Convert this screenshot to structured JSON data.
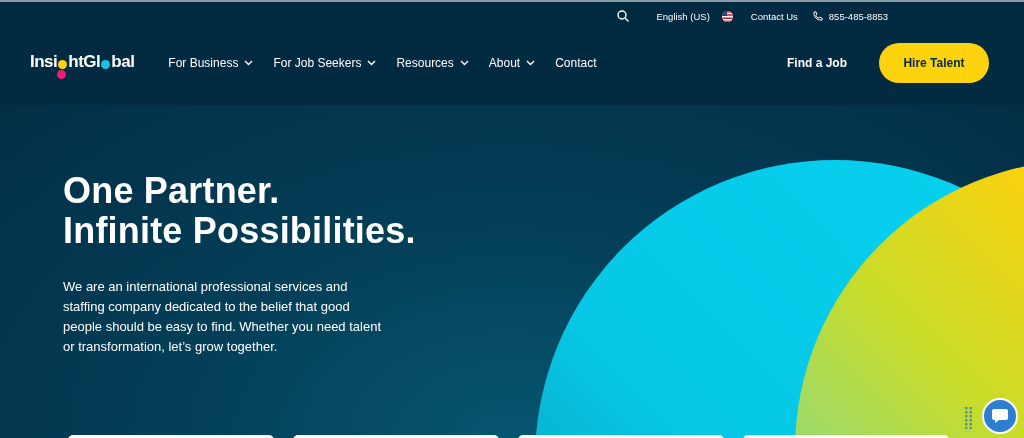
{
  "utility_bar": {
    "language": "English (US)",
    "contact": "Contact Us",
    "phone": "855-485-8853"
  },
  "logo": {
    "parts": [
      "Insi",
      "htGl",
      "bal"
    ]
  },
  "nav": [
    {
      "label": "For Business",
      "has_menu": true
    },
    {
      "label": "For Job Seekers",
      "has_menu": true
    },
    {
      "label": "Resources",
      "has_menu": true
    },
    {
      "label": "About",
      "has_menu": true
    },
    {
      "label": "Contact",
      "has_menu": false
    }
  ],
  "actions": {
    "link": "Find a Job",
    "button": "Hire Talent"
  },
  "hero": {
    "headline": [
      "One Partner.",
      "Infinite Possibilities."
    ],
    "body": "We are an international professional services and staffing company dedicated to the belief that good people should be easy to find. Whether you need talent or transformation, let’s grow together."
  },
  "cards": [
    {
      "kind": "card"
    },
    {
      "kind": "card"
    },
    {
      "kind": "card"
    },
    {
      "kind": "card"
    }
  ]
}
